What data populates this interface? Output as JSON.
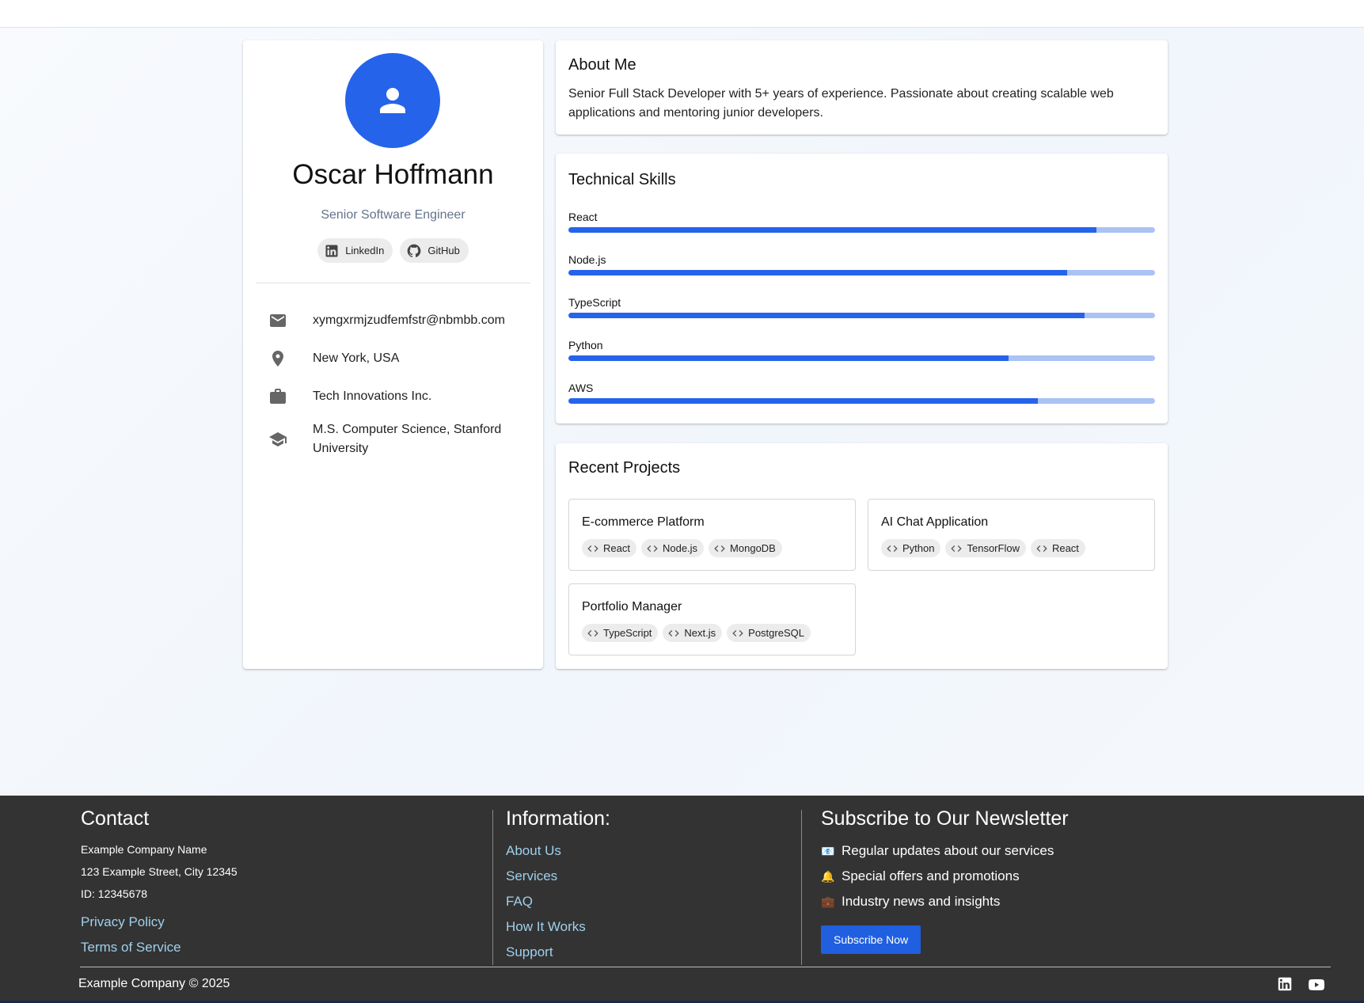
{
  "profile": {
    "name": "Oscar Hoffmann",
    "role": "Senior Software Engineer",
    "social": [
      {
        "label": "LinkedIn",
        "icon": "linkedin-icon"
      },
      {
        "label": "GitHub",
        "icon": "github-icon"
      }
    ],
    "info": [
      {
        "icon": "email-icon",
        "text": "xymgxrmjzudfemfstr@nbmbb.com"
      },
      {
        "icon": "location-pin-icon",
        "text": "New York, USA"
      },
      {
        "icon": "briefcase-icon",
        "text": "Tech Innovations Inc."
      },
      {
        "icon": "graduation-cap-icon",
        "text": "M.S. Computer Science, Stanford University"
      }
    ]
  },
  "about": {
    "title": "About Me",
    "text": "Senior Full Stack Developer with 5+ years of experience. Passionate about creating scalable web applications and mentoring junior developers."
  },
  "skills": {
    "title": "Technical Skills",
    "items": [
      {
        "name": "React",
        "level": 90
      },
      {
        "name": "Node.js",
        "level": 85
      },
      {
        "name": "TypeScript",
        "level": 88
      },
      {
        "name": "Python",
        "level": 75
      },
      {
        "name": "AWS",
        "level": 80
      }
    ]
  },
  "projects": {
    "title": "Recent Projects",
    "items": [
      {
        "title": "E-commerce Platform",
        "tags": [
          "React",
          "Node.js",
          "MongoDB"
        ]
      },
      {
        "title": "AI Chat Application",
        "tags": [
          "Python",
          "TensorFlow",
          "React"
        ]
      },
      {
        "title": "Portfolio Manager",
        "tags": [
          "TypeScript",
          "Next.js",
          "PostgreSQL"
        ]
      }
    ]
  },
  "footer": {
    "contact": {
      "title": "Contact",
      "company": "Example Company Name",
      "address": "123 Example Street, City 12345",
      "id": "ID: 12345678",
      "links": [
        "Privacy Policy",
        "Terms of Service"
      ]
    },
    "information": {
      "title": "Information:",
      "links": [
        "About Us",
        "Services",
        "FAQ",
        "How It Works",
        "Support"
      ]
    },
    "newsletter": {
      "title": "Subscribe to Our Newsletter",
      "items": [
        {
          "emoji": "📧",
          "text": "Regular updates about our services"
        },
        {
          "emoji": "🔔",
          "text": "Special offers and promotions"
        },
        {
          "emoji": "💼",
          "text": "Industry news and insights"
        }
      ],
      "button": "Subscribe Now"
    },
    "copyright": "Example Company © 2025",
    "social_icons": [
      "linkedin-icon",
      "youtube-icon"
    ]
  },
  "colors": {
    "accent": "#2563eb",
    "skill_track": "#abc2f4",
    "footer_bg": "#333333",
    "footer_link": "#9fd0ec"
  }
}
